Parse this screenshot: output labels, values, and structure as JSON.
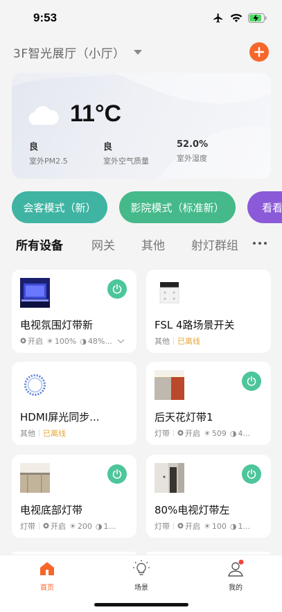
{
  "status_bar": {
    "time": "9:53"
  },
  "header": {
    "home_name": "3F智光展厅（小厅）"
  },
  "weather": {
    "temperature": "11°C",
    "stats": [
      {
        "value": "良",
        "label": "室外PM2.5"
      },
      {
        "value": "良",
        "label": "室外空气质量"
      },
      {
        "value": "52.0%",
        "label": "室外湿度"
      }
    ]
  },
  "modes": [
    {
      "label": "会客模式（新）",
      "color": "#3fb4a3"
    },
    {
      "label": "影院模式（标准新）",
      "color": "#45b98a"
    },
    {
      "label": "看看",
      "color": "#8a5ad8"
    }
  ],
  "tabs": [
    "所有设备",
    "网关",
    "其他",
    "射灯群组"
  ],
  "devices": [
    {
      "name": "电视氛围灯带新",
      "meta": {
        "status": "开启",
        "brightness": "100%",
        "color_temp": "48%..."
      }
    },
    {
      "name": "FSL 4路场景开关",
      "meta": {
        "category": "其他",
        "status": "已离线"
      }
    },
    {
      "name": "HDMI屏光同步...",
      "meta": {
        "category": "其他",
        "status": "已离线"
      }
    },
    {
      "name": "后天花灯带1",
      "meta": {
        "category": "灯带",
        "status": "开启",
        "brightness": "509",
        "color_temp": "4..."
      }
    },
    {
      "name": "电视底部灯带",
      "meta": {
        "category": "灯带",
        "status": "开启",
        "brightness": "200",
        "color_temp": "1..."
      }
    },
    {
      "name": "80%电视灯带左",
      "meta": {
        "category": "灯带",
        "status": "开启",
        "brightness": "100",
        "color_temp": "1..."
      }
    }
  ],
  "tabbar": [
    {
      "label": "首页",
      "icon": "home-icon",
      "active": true
    },
    {
      "label": "场景",
      "icon": "bulb-icon",
      "active": false
    },
    {
      "label": "我的",
      "icon": "user-icon",
      "active": false
    }
  ],
  "colors": {
    "accent": "#f7662a",
    "power": "#4cc69a",
    "offline": "#e8a534"
  }
}
